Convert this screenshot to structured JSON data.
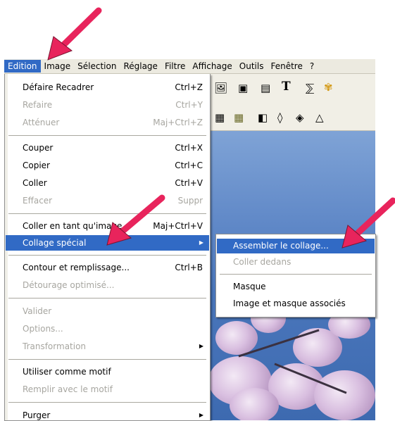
{
  "menubar": {
    "items": [
      "Edition",
      "Image",
      "Sélection",
      "Réglage",
      "Filtre",
      "Affichage",
      "Outils",
      "Fenêtre",
      "?"
    ]
  },
  "edit_menu": {
    "items": [
      {
        "label": "Défaire Recadrer",
        "shortcut": "Ctrl+Z",
        "enabled": true
      },
      {
        "label": "Refaire",
        "shortcut": "Ctrl+Y",
        "enabled": false
      },
      {
        "label": "Atténuer",
        "shortcut": "Maj+Ctrl+Z",
        "enabled": false
      },
      {
        "label": "Couper",
        "shortcut": "Ctrl+X",
        "enabled": true
      },
      {
        "label": "Copier",
        "shortcut": "Ctrl+C",
        "enabled": true
      },
      {
        "label": "Coller",
        "shortcut": "Ctrl+V",
        "enabled": true
      },
      {
        "label": "Effacer",
        "shortcut": "Suppr",
        "enabled": false
      },
      {
        "label": "Coller en tant qu'image",
        "shortcut": "Maj+Ctrl+V",
        "enabled": true
      },
      {
        "label": "Collage spécial",
        "shortcut": "",
        "enabled": true,
        "submenu": true,
        "highlighted": true
      },
      {
        "label": "Contour et remplissage...",
        "shortcut": "Ctrl+B",
        "enabled": true
      },
      {
        "label": "Détourage optimisé...",
        "shortcut": "",
        "enabled": false
      },
      {
        "label": "Valider",
        "shortcut": "",
        "enabled": false
      },
      {
        "label": "Options...",
        "shortcut": "",
        "enabled": false
      },
      {
        "label": "Transformation",
        "shortcut": "",
        "enabled": false,
        "submenu": true
      },
      {
        "label": "Utiliser comme motif",
        "shortcut": "",
        "enabled": true
      },
      {
        "label": "Remplir avec le motif",
        "shortcut": "",
        "enabled": false
      },
      {
        "label": "Purger",
        "shortcut": "",
        "enabled": true,
        "submenu": true
      }
    ]
  },
  "paste_special_submenu": {
    "items": [
      {
        "label": "Assembler le collage...",
        "enabled": true,
        "highlighted": true
      },
      {
        "label": "Coller dedans",
        "enabled": false
      },
      {
        "label": "Masque",
        "enabled": true
      },
      {
        "label": "Image et masque associés",
        "enabled": true
      }
    ]
  },
  "toolbar": {
    "text_tool_glyph": "T"
  },
  "colors": {
    "highlight": "#316ac5",
    "menubar_bg": "#eceae0",
    "disabled_text": "#a7a6a0",
    "annotation_arrow": "#e8245c"
  }
}
